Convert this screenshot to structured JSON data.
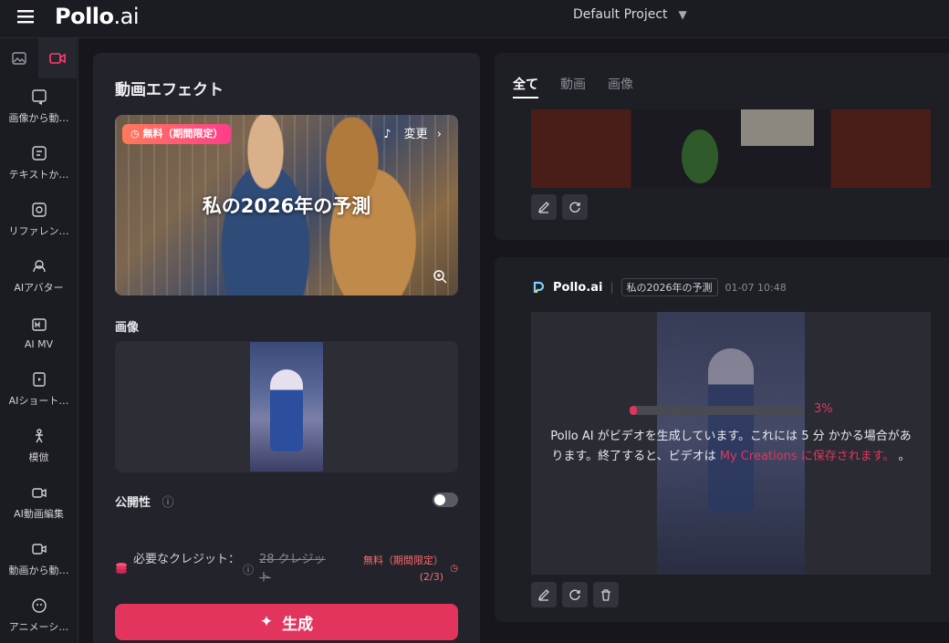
{
  "header": {
    "brand": "Pollo",
    "brand_suffix": ".ai",
    "project_name": "Default Project"
  },
  "sidebar": {
    "items": [
      {
        "label": "画像から動…",
        "icon": "image-to-video-icon"
      },
      {
        "label": "テキストか…",
        "icon": "text-to-video-icon"
      },
      {
        "label": "リファレン…",
        "icon": "reference-icon"
      },
      {
        "label": "AIアバター",
        "icon": "ai-avatar-icon"
      },
      {
        "label": "AI MV",
        "icon": "ai-mv-icon"
      },
      {
        "label": "AIショート…",
        "icon": "ai-short-icon"
      },
      {
        "label": "模倣",
        "icon": "imitate-icon"
      },
      {
        "label": "AI動画編集",
        "icon": "ai-video-edit-icon"
      },
      {
        "label": "動画から動…",
        "icon": "video-to-video-icon"
      },
      {
        "label": "アニメーシ…",
        "icon": "animation-icon"
      }
    ]
  },
  "left_panel": {
    "title": "動画エフェクト",
    "effect": {
      "badge": "無料（期間限定）",
      "change_label": "変更",
      "title": "私の2026年の予測"
    },
    "image_label": "画像",
    "visibility_label": "公開性",
    "credits": {
      "label": "必要なクレジット：",
      "old_price": "28 クレジット",
      "free_line1": "無料（期間限定）",
      "free_line2": "(2/3)"
    },
    "generate_label": "生成"
  },
  "right_panel": {
    "tabs": [
      "全て",
      "動画",
      "画像"
    ],
    "job": {
      "brand": "Pollo.ai",
      "tag": "私の2026年の予測",
      "timestamp": "01-07 10:48",
      "progress": 3,
      "progress_label": "3%",
      "message_a": "Pollo AI がビデオを生成しています。これには 5 分 かかる場合があります。終了すると、ビデオは ",
      "message_link": "My Creations に保存されます。",
      "message_b": " 。"
    }
  },
  "colors": {
    "accent": "#e3345e",
    "bg": "#16161c",
    "panel": "#23232b"
  }
}
